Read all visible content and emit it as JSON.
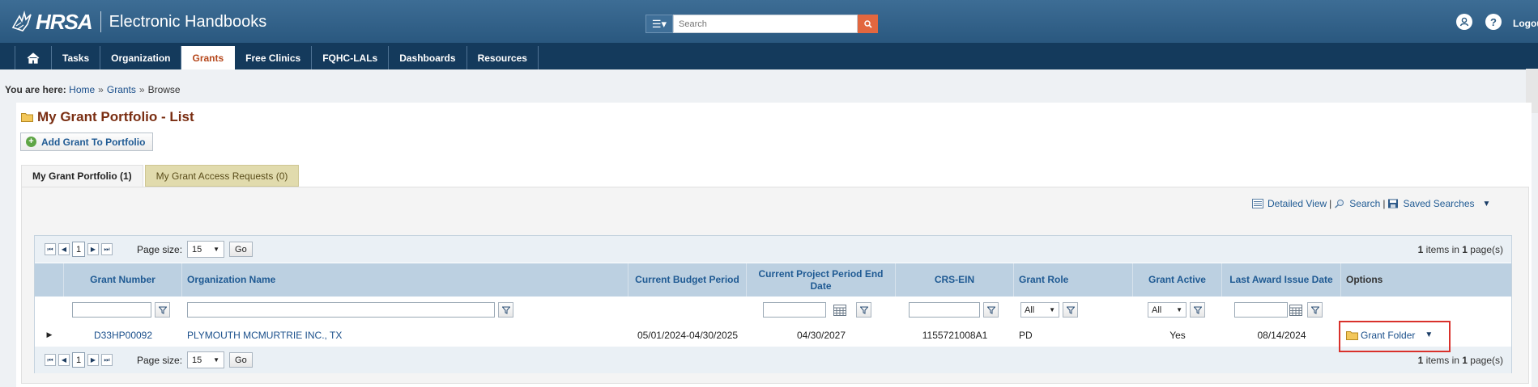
{
  "header": {
    "logo_text": "HRSA",
    "app_title": "Electronic Handbooks",
    "search_placeholder": "Search",
    "logout_label": "Logou"
  },
  "nav": {
    "items": [
      "Tasks",
      "Organization",
      "Grants",
      "Free Clinics",
      "FQHC-LALs",
      "Dashboards",
      "Resources"
    ],
    "active": "Grants"
  },
  "breadcrumb": {
    "prefix": "You are here:",
    "home": "Home",
    "grants": "Grants",
    "current": "Browse"
  },
  "page": {
    "title": "My Grant Portfolio - List",
    "add_button": "Add Grant To Portfolio"
  },
  "tabs": {
    "portfolio": "My Grant Portfolio (1)",
    "access": "My Grant Access Requests (0)"
  },
  "view_links": {
    "detailed": "Detailed View",
    "search": "Search",
    "saved": "Saved Searches"
  },
  "pager": {
    "page": "1",
    "page_size_label": "Page size:",
    "page_size": "15",
    "go": "Go",
    "items_count": "1",
    "items_mid": " items in ",
    "pages_count": "1",
    "pages_suffix": " page(s)"
  },
  "columns": {
    "grant_number": "Grant Number",
    "org_name": "Organization Name",
    "budget_period": "Current Budget Period",
    "project_end": "Current Project Period End Date",
    "crs_ein": "CRS-EIN",
    "grant_role": "Grant Role",
    "grant_active": "Grant Active",
    "last_award": "Last Award Issue Date",
    "options": "Options"
  },
  "filters": {
    "grant_role": "All",
    "grant_active": "All"
  },
  "row": {
    "grant_number": "D33HP00092",
    "org_name": "PLYMOUTH MCMURTRIE INC., TX",
    "budget_period": "05/01/2024-04/30/2025",
    "project_end": "04/30/2027",
    "crs_ein": "1155721008A1",
    "grant_role": "PD",
    "grant_active": "Yes",
    "last_award": "08/14/2024",
    "option_label": "Grant Folder"
  }
}
